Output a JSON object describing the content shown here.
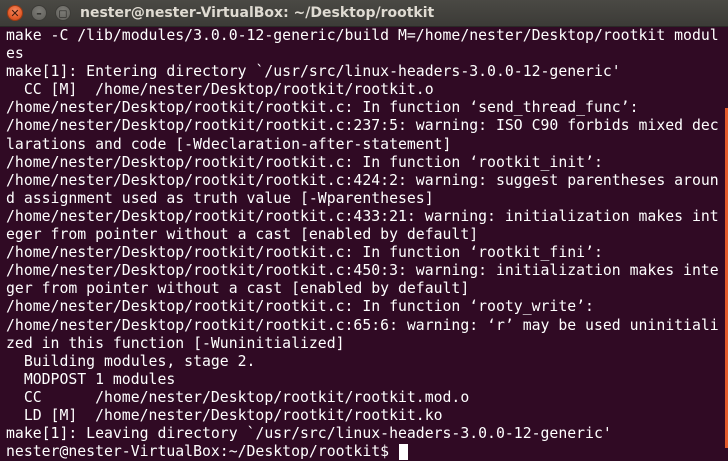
{
  "window": {
    "title": "nester@nester-VirtualBox: ~/Desktop/rootkit",
    "close_glyph": "✕",
    "minimize_glyph": "–",
    "maximize_glyph": "◻"
  },
  "terminal": {
    "lines": [
      "make -C /lib/modules/3.0.0-12-generic/build M=/home/nester/Desktop/rootkit modul",
      "es",
      "make[1]: Entering directory `/usr/src/linux-headers-3.0.0-12-generic'",
      "  CC [M]  /home/nester/Desktop/rootkit/rootkit.o",
      "/home/nester/Desktop/rootkit/rootkit.c: In function ‘send_thread_func’:",
      "/home/nester/Desktop/rootkit/rootkit.c:237:5: warning: ISO C90 forbids mixed dec",
      "larations and code [-Wdeclaration-after-statement]",
      "/home/nester/Desktop/rootkit/rootkit.c: In function ‘rootkit_init’:",
      "/home/nester/Desktop/rootkit/rootkit.c:424:2: warning: suggest parentheses aroun",
      "d assignment used as truth value [-Wparentheses]",
      "/home/nester/Desktop/rootkit/rootkit.c:433:21: warning: initialization makes int",
      "eger from pointer without a cast [enabled by default]",
      "/home/nester/Desktop/rootkit/rootkit.c: In function ‘rootkit_fini’:",
      "/home/nester/Desktop/rootkit/rootkit.c:450:3: warning: initialization makes inte",
      "ger from pointer without a cast [enabled by default]",
      "/home/nester/Desktop/rootkit/rootkit.c: In function ‘rooty_write’:",
      "/home/nester/Desktop/rootkit/rootkit.c:65:6: warning: ‘r’ may be used uninitiali",
      "zed in this function [-Wuninitialized]",
      "  Building modules, stage 2.",
      "  MODPOST 1 modules",
      "  CC      /home/nester/Desktop/rootkit/rootkit.mod.o",
      "  LD [M]  /home/nester/Desktop/rootkit/rootkit.ko",
      "make[1]: Leaving directory `/usr/src/linux-headers-3.0.0-12-generic'"
    ],
    "prompt": "nester@nester-VirtualBox:~/Desktop/rootkit$ "
  },
  "colors": {
    "terminal_background": "#300a24",
    "terminal_text": "#ffffff",
    "close_button": "#e35c2a",
    "titlebar": "#3c3b37"
  }
}
